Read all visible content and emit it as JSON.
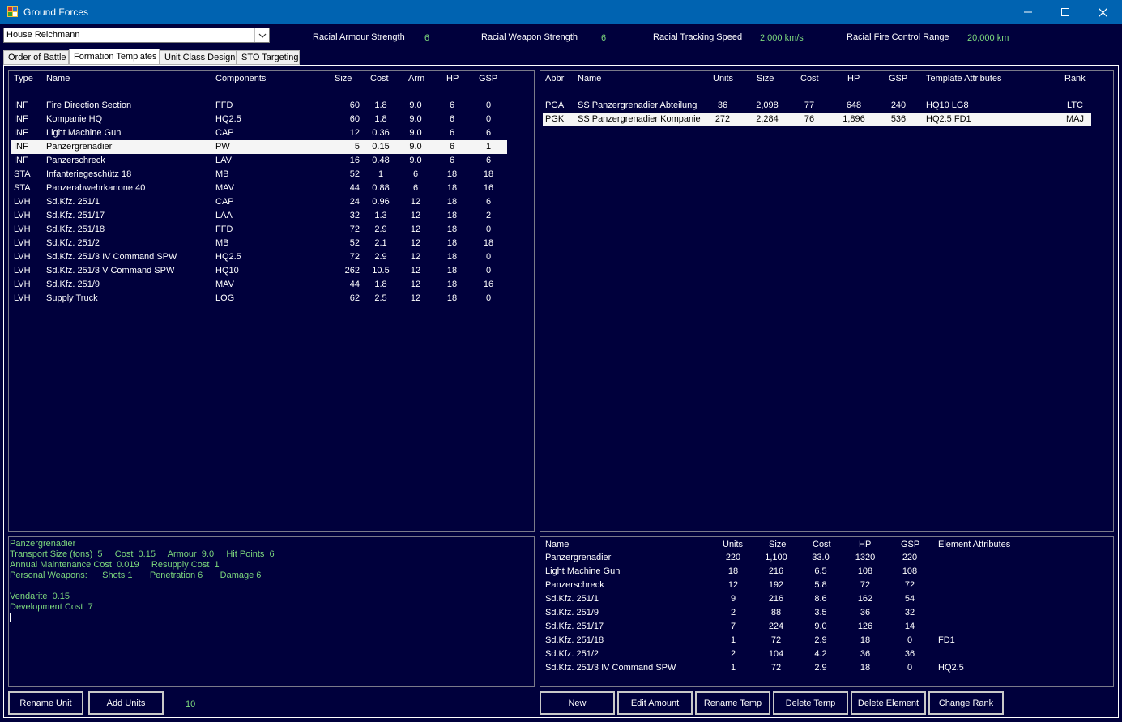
{
  "window": {
    "title": "Ground Forces"
  },
  "race_select": {
    "value": "House Reichmann"
  },
  "racial_stats": [
    {
      "label": "Racial Armour Strength",
      "value": "6"
    },
    {
      "label": "Racial Weapon Strength",
      "value": "6"
    },
    {
      "label": "Racial Tracking Speed",
      "value": "2,000 km/s"
    },
    {
      "label": "Racial Fire Control Range",
      "value": "20,000 km"
    }
  ],
  "tabs": [
    {
      "label": "Order of Battle",
      "active": false
    },
    {
      "label": "Formation Templates",
      "active": true
    },
    {
      "label": "Unit Class Design",
      "active": false
    },
    {
      "label": "STO Targeting",
      "active": false
    }
  ],
  "unit_classes": {
    "columns": [
      "Type",
      "Name",
      "Components",
      "Size",
      "Cost",
      "Arm",
      "HP",
      "GSP"
    ],
    "rows": [
      [
        "INF",
        "Fire Direction Section",
        "FFD",
        "60",
        "1.8",
        "9.0",
        "6",
        "0"
      ],
      [
        "INF",
        "Kompanie HQ",
        "HQ2.5",
        "60",
        "1.8",
        "9.0",
        "6",
        "0"
      ],
      [
        "INF",
        "Light Machine Gun",
        "CAP",
        "12",
        "0.36",
        "9.0",
        "6",
        "6"
      ],
      [
        "INF",
        "Panzergrenadier",
        "PW",
        "5",
        "0.15",
        "9.0",
        "6",
        "1"
      ],
      [
        "INF",
        "Panzerschreck",
        "LAV",
        "16",
        "0.48",
        "9.0",
        "6",
        "6"
      ],
      [
        "STA",
        "Infanteriegeschütz 18",
        "MB",
        "52",
        "1",
        "6",
        "18",
        "18"
      ],
      [
        "STA",
        "Panzerabwehrkanone 40",
        "MAV",
        "44",
        "0.88",
        "6",
        "18",
        "16"
      ],
      [
        "LVH",
        "Sd.Kfz. 251/1",
        "CAP",
        "24",
        "0.96",
        "12",
        "18",
        "6"
      ],
      [
        "LVH",
        "Sd.Kfz. 251/17",
        "LAA",
        "32",
        "1.3",
        "12",
        "18",
        "2"
      ],
      [
        "LVH",
        "Sd.Kfz. 251/18",
        "FFD",
        "72",
        "2.9",
        "12",
        "18",
        "0"
      ],
      [
        "LVH",
        "Sd.Kfz. 251/2",
        "MB",
        "52",
        "2.1",
        "12",
        "18",
        "18"
      ],
      [
        "LVH",
        "Sd.Kfz. 251/3 IV Command SPW",
        "HQ2.5",
        "72",
        "2.9",
        "12",
        "18",
        "0"
      ],
      [
        "LVH",
        "Sd.Kfz. 251/3 V Command SPW",
        "HQ10",
        "262",
        "10.5",
        "12",
        "18",
        "0"
      ],
      [
        "LVH",
        "Sd.Kfz. 251/9",
        "MAV",
        "44",
        "1.8",
        "12",
        "18",
        "16"
      ],
      [
        "LVH",
        "Supply Truck",
        "LOG",
        "62",
        "2.5",
        "12",
        "18",
        "0"
      ]
    ],
    "selected_index": 3
  },
  "templates": {
    "columns": [
      "Abbr",
      "Name",
      "Units",
      "Size",
      "Cost",
      "HP",
      "GSP",
      "Template Attributes",
      "Rank"
    ],
    "rows": [
      [
        "PGA",
        "SS Panzergrenadier Abteilung",
        "36",
        "2,098",
        "77",
        "648",
        "240",
        "HQ10  LG8",
        "LTC"
      ],
      [
        "PGK",
        "SS Panzergrenadier Kompanie",
        "272",
        "2,284",
        "76",
        "1,896",
        "536",
        "HQ2.5  FD1",
        "MAJ"
      ]
    ],
    "selected_index": 1
  },
  "unit_info": {
    "lines": [
      "Panzergrenadier",
      "Transport Size (tons)  5     Cost  0.15     Armour  9.0     Hit Points  6",
      "Annual Maintenance Cost  0.019     Resupply Cost  1",
      "Personal Weapons:      Shots 1       Penetration 6       Damage 6",
      "",
      "Vendarite  0.15",
      "Development Cost  7"
    ]
  },
  "elements": {
    "columns": [
      "Name",
      "Units",
      "Size",
      "Cost",
      "HP",
      "GSP",
      "Element Attributes"
    ],
    "rows": [
      [
        "Panzergrenadier",
        "220",
        "1,100",
        "33.0",
        "1320",
        "220",
        ""
      ],
      [
        "Light Machine Gun",
        "18",
        "216",
        "6.5",
        "108",
        "108",
        ""
      ],
      [
        "Panzerschreck",
        "12",
        "192",
        "5.8",
        "72",
        "72",
        ""
      ],
      [
        "Sd.Kfz. 251/1",
        "9",
        "216",
        "8.6",
        "162",
        "54",
        ""
      ],
      [
        "Sd.Kfz. 251/9",
        "2",
        "88",
        "3.5",
        "36",
        "32",
        ""
      ],
      [
        "Sd.Kfz. 251/17",
        "7",
        "224",
        "9.0",
        "126",
        "14",
        ""
      ],
      [
        "Sd.Kfz. 251/18",
        "1",
        "72",
        "2.9",
        "18",
        "0",
        "FD1"
      ],
      [
        "Sd.Kfz. 251/2",
        "2",
        "104",
        "4.2",
        "36",
        "36",
        ""
      ],
      [
        "Sd.Kfz. 251/3 IV Command SPW",
        "1",
        "72",
        "2.9",
        "18",
        "0",
        "HQ2.5"
      ]
    ]
  },
  "left_buttons": {
    "rename_unit": "Rename Unit",
    "add_units": "Add Units",
    "units_to_add": "10"
  },
  "right_buttons": {
    "new": "New",
    "edit_amount": "Edit Amount",
    "rename_temp": "Rename Temp",
    "delete_temp": "Delete Temp",
    "delete_element": "Delete Element",
    "change_rank": "Change Rank"
  },
  "colors": {
    "background": "#00003c",
    "titlebar": "#0063b1",
    "green_text": "#7dd87d",
    "selected_row": "#f5f5f5"
  }
}
